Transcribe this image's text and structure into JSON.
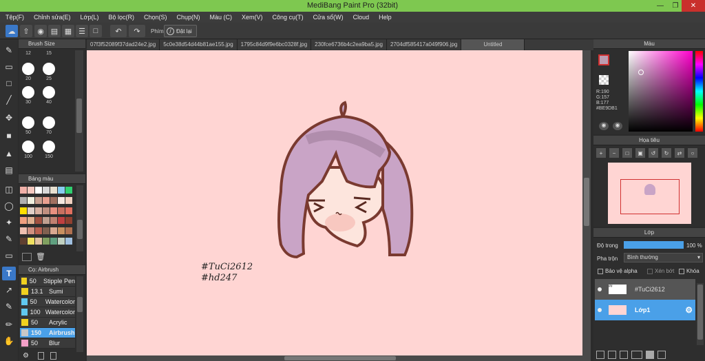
{
  "window": {
    "title": "MediBang Paint Pro (32bit)"
  },
  "menu": [
    "Tệp(F)",
    "Chỉnh sửa(E)",
    "Lớp(L)",
    "Bộ lọc(R)",
    "Chọn(S)",
    "Chụp(N)",
    "Màu (C)",
    "Xem(V)",
    "Công cụ(T)",
    "Cửa sổ(W)",
    "Cloud",
    "Help"
  ],
  "toolbar": {
    "phim_label": "Phím",
    "reset_label": "Đặt lại"
  },
  "brush_size": {
    "title": "Brush Size",
    "sizes": [
      "12",
      "15",
      "20",
      "25",
      "30",
      "40",
      "50",
      "70",
      "100",
      "150"
    ]
  },
  "palette": {
    "title": "Bảng màu",
    "colors": [
      "#f0b0a8",
      "#f5c9c0",
      "#ffffff",
      "#d8d8d8",
      "#e8e0d0",
      "#88ccf0",
      "#30d070",
      "#b0b0b0",
      "#f0f0e0",
      "#c8a090",
      "#e8a090",
      "#a07060",
      "#f4e8e0",
      "#f0d0c0",
      "#ffe000",
      "#e0d0c8",
      "#d8b0a0",
      "#c09080",
      "#e89080",
      "#c87060",
      "#e07060",
      "#f0a080",
      "#e0b090",
      "#a05040",
      "#c0a090",
      "#c08070",
      "#c04040",
      "#904030",
      "#f0c0b0",
      "#d09080",
      "#b86050",
      "#806050",
      "#d8a890",
      "#c89060",
      "#b07050",
      "#604030",
      "#f0e060",
      "#e0c0a0",
      "#80a060",
      "#60a080",
      "#c0d0c0",
      "#a0c0e0"
    ]
  },
  "brushes": {
    "title": "Cọ: Airbrush",
    "items": [
      {
        "size": "50",
        "name": "Stipple Pen",
        "color": "#f0d020"
      },
      {
        "size": "13.1",
        "name": "Sumi",
        "color": "#f0d020"
      },
      {
        "size": "50",
        "name": "Watercolor",
        "color": "#60c8f0"
      },
      {
        "size": "100",
        "name": "Watercolor",
        "color": "#60c8f0"
      },
      {
        "size": "50",
        "name": "Acrylic",
        "color": "#f0d020"
      },
      {
        "size": "150",
        "name": "Airbrush",
        "color": "#c8c8c8"
      },
      {
        "size": "50",
        "name": "Blur",
        "color": "#f4a0c8"
      }
    ]
  },
  "tabs": [
    "07f3f52089f37dad24e2.jpg",
    "5c0e38d54d44b81ae155.jpg",
    "1795c84d9f9e6bc0328f.jpg",
    "230fce6736b4c2ea9ba5.jpg",
    "2704df585417a049f906.jpg",
    "Untitled"
  ],
  "canvas": {
    "bg": "#ffd5d3",
    "text_line1": "#TuCi2612",
    "text_line2": "#hd247"
  },
  "color_panel": {
    "title": "Màu",
    "r": "R:190",
    "g": "G:157",
    "b": "B:177",
    "hex": "#BE9DB1",
    "main_color": "#be9db1"
  },
  "navigator": {
    "title": "Họa tiêu"
  },
  "layer_panel": {
    "title": "Lớp",
    "opacity_label": "Độ trong",
    "opacity_value": "100 %",
    "opacity_fraction": 1.0,
    "blend_label": "Pha trộn",
    "blend_value": "Bình thường",
    "protect_alpha": "Bảo vệ alpha",
    "clipping": "Xén bớt",
    "lock": "Khóa",
    "layers": [
      {
        "name": "#TuCi2612",
        "selected": false
      },
      {
        "name": "Lớp1",
        "selected": true
      }
    ]
  }
}
